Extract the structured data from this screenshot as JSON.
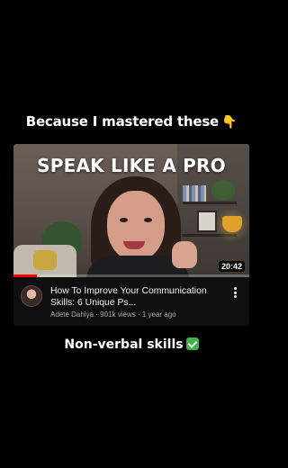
{
  "caption_top": {
    "text": "Because I mastered these",
    "emoji": "👇"
  },
  "video": {
    "thumbnail_text": "SPEAK LIKE A PRO",
    "duration": "20:42",
    "progress_fraction": 0.1,
    "title": "How To Improve Your Communication Skills: 6 Unique Ps...",
    "channel": "Adete Dahiya",
    "views": "901k views",
    "age": "1 year ago",
    "subtitle": "Adete Dahiya · 901k views · 1 year ago",
    "accent_color": "#ff0000"
  },
  "caption_bottom": {
    "text": "Non-verbal skills",
    "icon": "check-mark-button-icon",
    "icon_color": "#3fb24b"
  }
}
